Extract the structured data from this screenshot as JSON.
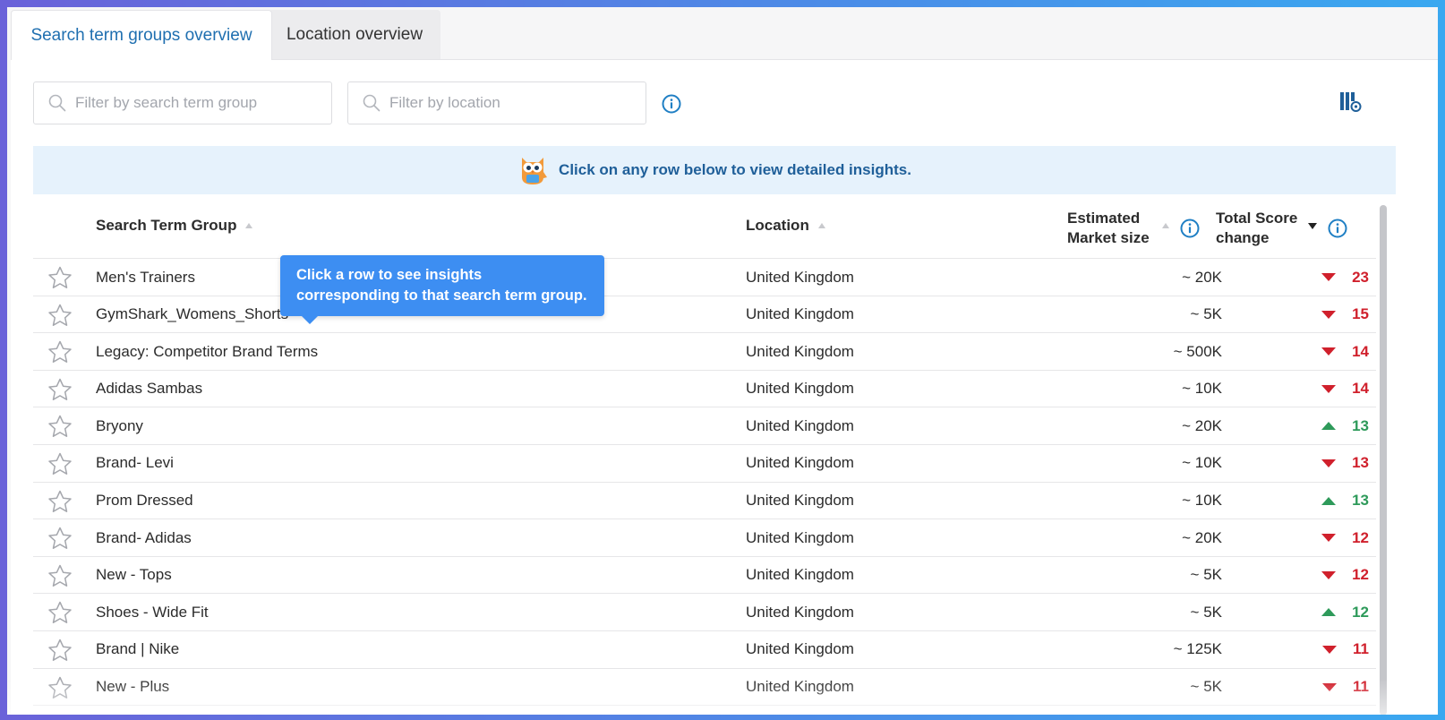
{
  "tabs": [
    {
      "label": "Search term groups overview",
      "active": true
    },
    {
      "label": "Location overview",
      "active": false
    }
  ],
  "filters": {
    "search_term_placeholder": "Filter by search term group",
    "location_placeholder": "Filter by location"
  },
  "banner": {
    "text": "Click on any row below to view detailed insights."
  },
  "tooltip": {
    "text": "Click a row to see insights corresponding to that search term group."
  },
  "table": {
    "columns": {
      "name": "Search Term Group",
      "location": "Location",
      "size_line1": "Estimated",
      "size_line2": "Market size",
      "change_line1": "Total Score",
      "change_line2": "change"
    },
    "rows": [
      {
        "name": "Men's Trainers",
        "location": "United Kingdom",
        "size": "~ 20K",
        "change": "23",
        "direction": "down"
      },
      {
        "name": "GymShark_Womens_Shorts",
        "location": "United Kingdom",
        "size": "~ 5K",
        "change": "15",
        "direction": "down"
      },
      {
        "name": "Legacy: Competitor Brand Terms",
        "location": "United Kingdom",
        "size": "~ 500K",
        "change": "14",
        "direction": "down"
      },
      {
        "name": "Adidas Sambas",
        "location": "United Kingdom",
        "size": "~ 10K",
        "change": "14",
        "direction": "down"
      },
      {
        "name": "Bryony",
        "location": "United Kingdom",
        "size": "~ 20K",
        "change": "13",
        "direction": "up"
      },
      {
        "name": "Brand- Levi",
        "location": "United Kingdom",
        "size": "~ 10K",
        "change": "13",
        "direction": "down"
      },
      {
        "name": "Prom Dressed",
        "location": "United Kingdom",
        "size": "~ 10K",
        "change": "13",
        "direction": "up"
      },
      {
        "name": "Brand- Adidas",
        "location": "United Kingdom",
        "size": "~ 20K",
        "change": "12",
        "direction": "down"
      },
      {
        "name": "New - Tops",
        "location": "United Kingdom",
        "size": "~ 5K",
        "change": "12",
        "direction": "down"
      },
      {
        "name": "Shoes - Wide Fit",
        "location": "United Kingdom",
        "size": "~ 5K",
        "change": "12",
        "direction": "up"
      },
      {
        "name": "Brand | Nike",
        "location": "United Kingdom",
        "size": "~ 125K",
        "change": "11",
        "direction": "down"
      },
      {
        "name": "New - Plus",
        "location": "United Kingdom",
        "size": "~ 5K",
        "change": "11",
        "direction": "down"
      }
    ]
  },
  "icons": {
    "search": "search-icon",
    "info": "info-icon",
    "star": "star-outline-icon",
    "columns_settings": "column-settings-icon",
    "mascot": "owl-mascot-icon"
  },
  "colors": {
    "accent": "#1f6fb0",
    "banner_bg": "#e6f2fc",
    "tooltip_bg": "#3d8ef2",
    "negative": "#d0202c",
    "positive": "#2e9a5a"
  }
}
